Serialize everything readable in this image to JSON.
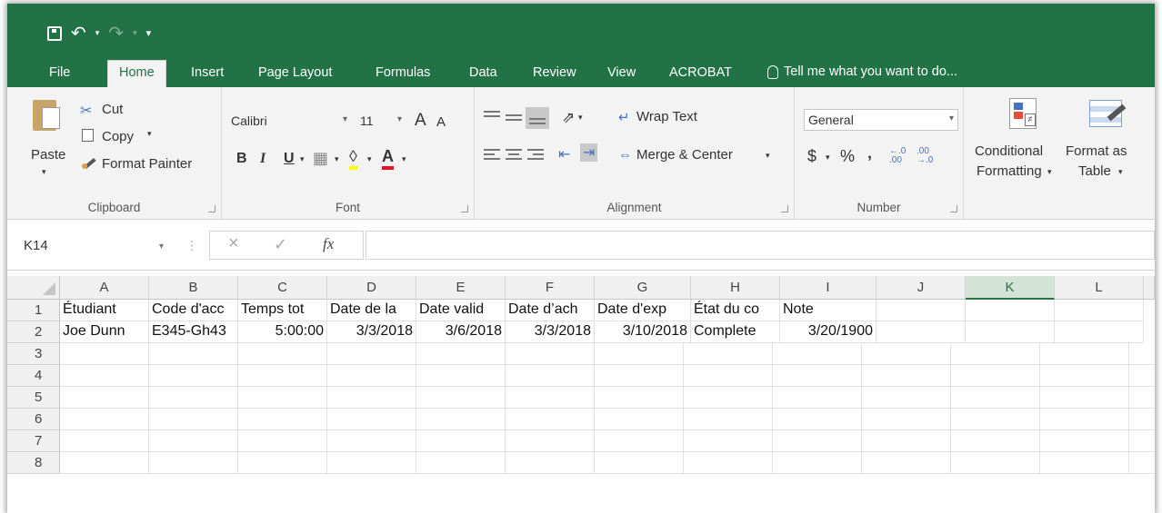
{
  "qat": {
    "save_icon": "save-icon",
    "undo_icon": "undo-icon",
    "redo_icon": "redo-icon"
  },
  "tabs": [
    {
      "label": "File"
    },
    {
      "label": "Home"
    },
    {
      "label": "Insert"
    },
    {
      "label": "Page Layout"
    },
    {
      "label": "Formulas"
    },
    {
      "label": "Data"
    },
    {
      "label": "Review"
    },
    {
      "label": "View"
    },
    {
      "label": "ACROBAT"
    }
  ],
  "tellme": "Tell me what you want to do...",
  "ribbon": {
    "clipboard": {
      "paste": "Paste",
      "cut": "Cut",
      "copy": "Copy",
      "format_painter": "Format Painter",
      "label": "Clipboard"
    },
    "font": {
      "name": "Calibri",
      "size": "11",
      "grow": "A",
      "shrink": "A",
      "bold": "B",
      "italic": "I",
      "underline": "U",
      "label": "Font"
    },
    "alignment": {
      "wrap": "Wrap Text",
      "merge": "Merge & Center",
      "label": "Alignment"
    },
    "number": {
      "format": "General",
      "currency": "$",
      "percent": "%",
      "comma": "‚",
      "inc": "←.0 .00",
      "dec": ".00 →.0",
      "label": "Number"
    },
    "styles": {
      "conditional_line1": "Conditional",
      "conditional_line2": "Formatting",
      "table_line1": "Format as",
      "table_line2": "Table"
    }
  },
  "formula_bar": {
    "name_box": "K14",
    "cancel": "×",
    "enter": "✓",
    "fx": "fx",
    "value": ""
  },
  "columns": [
    "A",
    "B",
    "C",
    "D",
    "E",
    "F",
    "G",
    "H",
    "I",
    "J",
    "K",
    "L"
  ],
  "selected_column": "K",
  "rows": [
    "1",
    "2",
    "3",
    "4",
    "5",
    "6",
    "7",
    "8"
  ],
  "cells": {
    "row1": [
      "Étudiant",
      "Code d'acc",
      "Temps tot",
      "Date de la",
      "Date valid",
      "Date d’ach",
      "Date d'exp",
      "État du co",
      "Note",
      "",
      "",
      ""
    ],
    "row2": [
      "Joe Dunn",
      "E345-Gh43",
      "5:00:00",
      "3/3/2018",
      "3/6/2018",
      "3/3/2018",
      "3/10/2018",
      "Complete",
      "3/20/1900",
      "",
      "",
      ""
    ]
  },
  "colors": {
    "excel_green": "#217346",
    "ribbon_bg": "#f3f3f3"
  }
}
